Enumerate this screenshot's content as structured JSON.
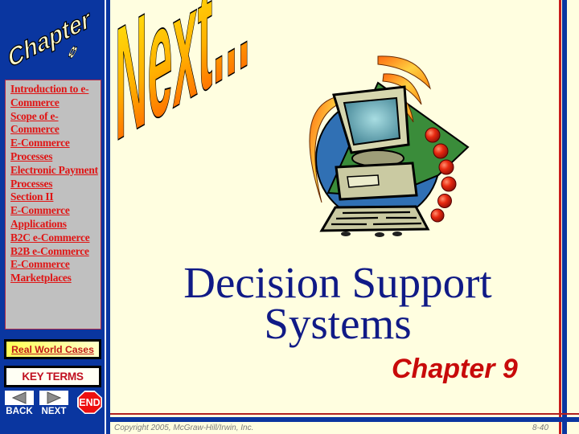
{
  "sidebar": {
    "logo": {
      "word": "Chapter",
      "number": "8"
    },
    "nav_links": [
      "Introduction to e-Commerce",
      "Scope of e-Commerce",
      "E-Commerce Processes",
      "Electronic Payment Processes",
      "Section II",
      "E-Commerce Applications",
      "B2C e-Commerce",
      "B2B e-Commerce",
      "E-Commerce Marketplaces"
    ],
    "real_world_cases": "Real World Cases",
    "key_terms": "KEY TERMS",
    "back_label": "BACK",
    "next_label": "NEXT",
    "end_label": "END"
  },
  "main": {
    "wordart": "Next...",
    "clipart": "computer-icon",
    "title_line1": "Decision Support",
    "title_line2": "Systems",
    "chapter": "Chapter 9"
  },
  "footer": {
    "copyright": "Copyright 2005, McGraw-Hill/Irwin, Inc.",
    "page_number": "8-40"
  },
  "colors": {
    "sidebar_blue": "#0a36a0",
    "background_cream": "#fffee0",
    "link_red": "#e01414",
    "title_navy": "#101a86",
    "chapter_red": "#c80a0a"
  }
}
